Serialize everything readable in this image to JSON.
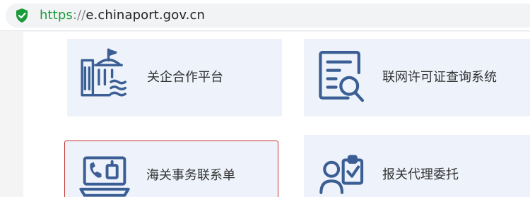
{
  "browser": {
    "url_scheme": "https",
    "url_separator": "://",
    "url_host": "e.chinaport.gov.cn",
    "secure_color": "#1a9b3a"
  },
  "cards": [
    {
      "label": "关企合作平台",
      "icon": "government-building-icon"
    },
    {
      "label": "联网许可证查询系统",
      "icon": "document-search-icon"
    },
    {
      "label": "海关事务联系单",
      "icon": "laptop-contact-icon"
    },
    {
      "label": "报关代理委托",
      "icon": "agent-clipboard-icon"
    }
  ],
  "colors": {
    "icon_blue": "#3b5f95",
    "card_bg": "#eef3fb",
    "selected_border": "#c4302b"
  }
}
